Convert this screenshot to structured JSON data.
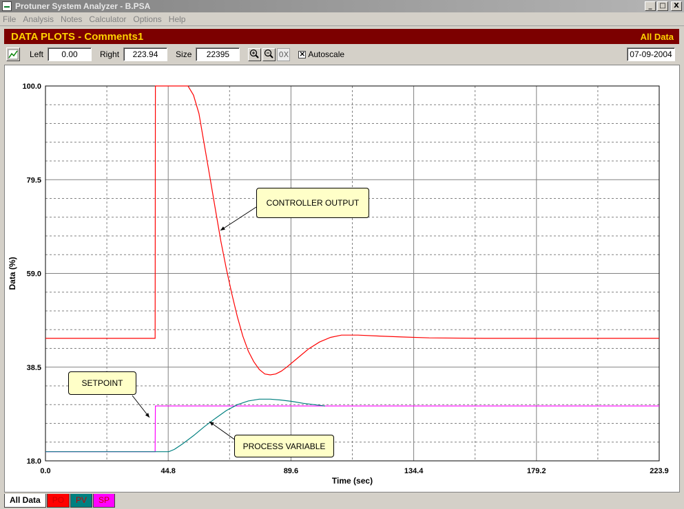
{
  "window": {
    "title": "Protuner System Analyzer - B.PSA",
    "minimize_glyph": "_",
    "maximize_glyph": "□",
    "close_glyph": "X"
  },
  "menu": [
    "File",
    "Analysis",
    "Notes",
    "Calculator",
    "Options",
    "Help"
  ],
  "header": {
    "title": "DATA PLOTS - Comments1",
    "right_label": "All Data"
  },
  "toolbar": {
    "left_label": "Left",
    "left_value": "0.00",
    "right_label": "Right",
    "right_value": "223.94",
    "size_label": "Size",
    "size_value": "22395",
    "zoom_in_icon": "zoom-in-icon",
    "zoom_out_icon": "zoom-out-icon",
    "zoom_reset_glyph": "0X",
    "autoscale_label": "Autoscale",
    "autoscale_checked": true,
    "date": "07-09-2004"
  },
  "chart_data": {
    "type": "line",
    "xlabel": "Time (sec)",
    "ylabel": "Data (%)",
    "xlim": [
      0,
      223.9
    ],
    "ylim": [
      18.0,
      100.0
    ],
    "x_ticks": [
      "0.0",
      "44.8",
      "89.6",
      "134.4",
      "179.2",
      "223.9"
    ],
    "y_ticks": [
      "18.0",
      "38.5",
      "59.0",
      "79.5",
      "100.0"
    ],
    "grid": true,
    "colors": {
      "PO": "#ff0000",
      "PV": "#008080",
      "SP": "#ff00ff"
    },
    "series": [
      {
        "name": "PO",
        "points": [
          [
            0,
            44.8
          ],
          [
            40,
            44.8
          ],
          [
            40.1,
            100
          ],
          [
            52,
            100
          ],
          [
            54,
            98
          ],
          [
            56,
            94
          ],
          [
            58,
            87
          ],
          [
            60,
            80
          ],
          [
            62,
            73
          ],
          [
            64,
            66
          ],
          [
            66,
            60
          ],
          [
            68,
            54.5
          ],
          [
            70,
            49.5
          ],
          [
            72,
            45.3
          ],
          [
            74,
            42
          ],
          [
            76,
            39.7
          ],
          [
            78,
            38
          ],
          [
            80,
            37
          ],
          [
            82,
            36.8
          ],
          [
            84,
            37
          ],
          [
            86,
            37.6
          ],
          [
            88,
            38.5
          ],
          [
            92,
            40.5
          ],
          [
            96,
            42.5
          ],
          [
            100,
            44
          ],
          [
            104,
            45
          ],
          [
            108,
            45.5
          ],
          [
            114,
            45.5
          ],
          [
            122,
            45.3
          ],
          [
            130,
            45.1
          ],
          [
            140,
            44.9
          ],
          [
            160,
            44.8
          ],
          [
            223.9,
            44.8
          ]
        ]
      },
      {
        "name": "PV",
        "points": [
          [
            0,
            20
          ],
          [
            45,
            20
          ],
          [
            47,
            20.5
          ],
          [
            50,
            21.7
          ],
          [
            54,
            23.5
          ],
          [
            58,
            25.5
          ],
          [
            62,
            27.3
          ],
          [
            66,
            29
          ],
          [
            70,
            30.3
          ],
          [
            74,
            31.1
          ],
          [
            78,
            31.5
          ],
          [
            82,
            31.5
          ],
          [
            86,
            31.3
          ],
          [
            90,
            31
          ],
          [
            94,
            30.6
          ],
          [
            98,
            30.3
          ],
          [
            102,
            30
          ]
        ]
      },
      {
        "name": "SP",
        "points": [
          [
            0,
            20
          ],
          [
            40,
            20
          ],
          [
            40.1,
            30
          ],
          [
            223.9,
            30
          ]
        ]
      }
    ]
  },
  "annotations": {
    "controller_output": "CONTROLLER OUTPUT",
    "setpoint": "SETPOINT",
    "process_variable": "PROCESS VARIABLE"
  },
  "tabs": [
    "All Data",
    "PO",
    "PV",
    "SP"
  ],
  "tab_colors": [
    "#ffffff",
    "#ff0000",
    "#008080",
    "#ff00ff"
  ]
}
